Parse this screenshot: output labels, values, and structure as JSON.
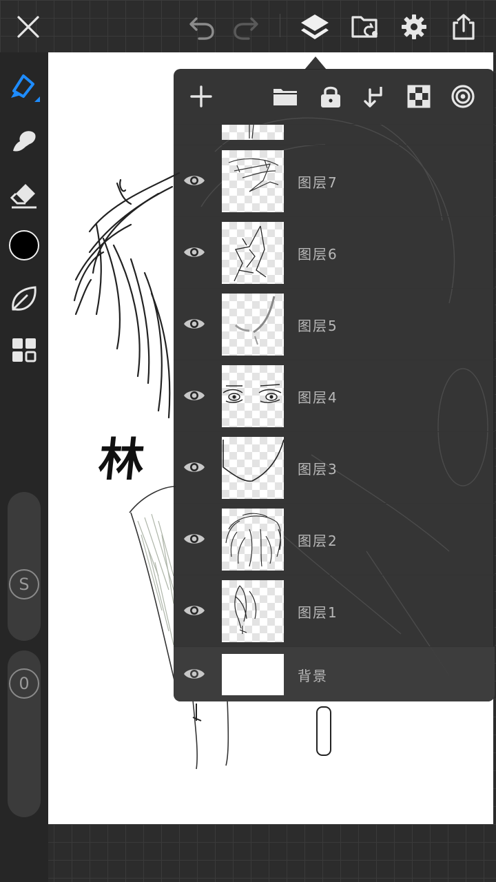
{
  "toolbar": {
    "icons": [
      "close-icon",
      "undo-icon",
      "redo-icon",
      "layers-icon",
      "gallery-icon",
      "settings-icon",
      "share-icon"
    ]
  },
  "tools": {
    "icons": [
      "pen-icon",
      "smudge-icon",
      "eraser-icon",
      "color-swatch",
      "leaf-icon",
      "grid-icon"
    ],
    "active_color": "#000000",
    "accent": "#1e8cff"
  },
  "sliders": {
    "size_label": "S",
    "opacity_label": "0"
  },
  "layers_panel": {
    "toolbar_icons": [
      "add-icon",
      "folder-icon",
      "lock-icon",
      "merge-down-icon",
      "checker-icon",
      "target-icon"
    ],
    "layers": [
      {
        "name": "图层7",
        "visible": true
      },
      {
        "name": "图层6",
        "visible": true
      },
      {
        "name": "图层5",
        "visible": true
      },
      {
        "name": "图层4",
        "visible": true
      },
      {
        "name": "图层3",
        "visible": true
      },
      {
        "name": "图层2",
        "visible": true
      },
      {
        "name": "图层1",
        "visible": true
      },
      {
        "name": "背景",
        "visible": true
      }
    ]
  },
  "canvas": {
    "signature_text": "林"
  }
}
